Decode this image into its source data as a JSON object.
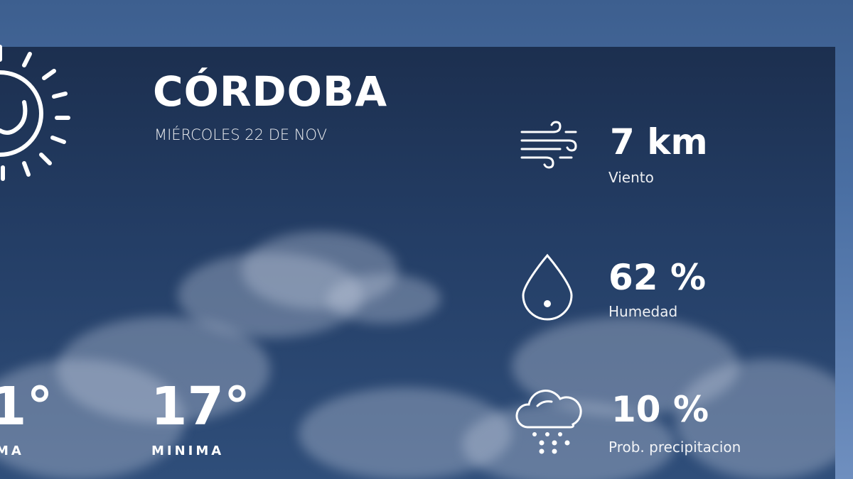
{
  "location": {
    "city": "CÓRDOBA",
    "date": "MIÉRCOLES 22 DE NOV"
  },
  "temperatures": {
    "max_partial": "1°",
    "max_label_partial": "MA",
    "min": "17°",
    "min_label": "MINIMA"
  },
  "stats": {
    "wind": {
      "value": "7 km",
      "label": "Viento",
      "icon": "wind-icon"
    },
    "humidity": {
      "value": "62 %",
      "label": "Humedad",
      "icon": "droplet-icon"
    },
    "precipitation": {
      "value": "10 %",
      "label": "Prob. precipitacion",
      "icon": "rain-cloud-icon"
    }
  },
  "condition_icon": "sun-icon",
  "colors": {
    "panel": "#1c2f4f",
    "background": "#3d5f8f",
    "text": "#ffffff"
  }
}
